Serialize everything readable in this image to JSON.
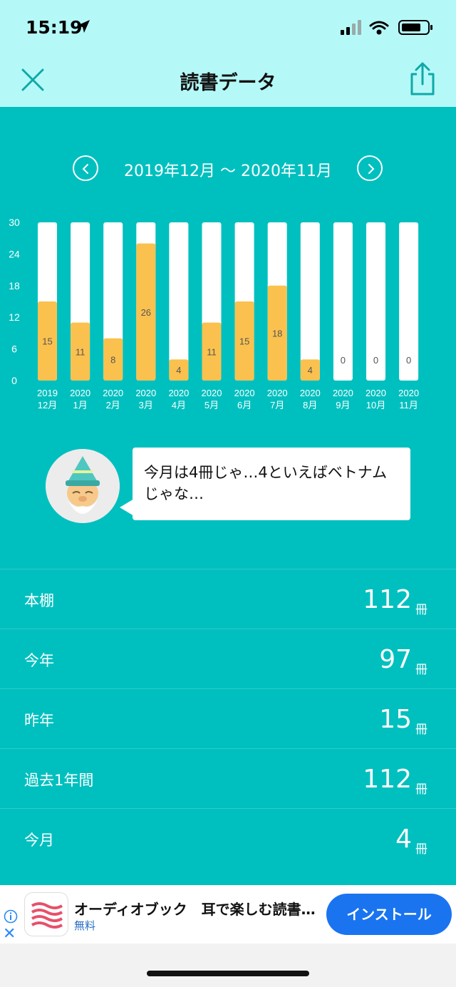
{
  "status": {
    "time": "15:19"
  },
  "nav": {
    "title": "読書データ"
  },
  "range": {
    "label": "2019年12月 〜 2020年11月"
  },
  "chart_data": {
    "type": "bar",
    "ylim": [
      0,
      30
    ],
    "yticks": [
      "30",
      "24",
      "18",
      "12",
      "6",
      "0"
    ],
    "categories": [
      [
        "2019",
        "12月"
      ],
      [
        "2020",
        "1月"
      ],
      [
        "2020",
        "2月"
      ],
      [
        "2020",
        "3月"
      ],
      [
        "2020",
        "4月"
      ],
      [
        "2020",
        "5月"
      ],
      [
        "2020",
        "6月"
      ],
      [
        "2020",
        "7月"
      ],
      [
        "2020",
        "8月"
      ],
      [
        "2020",
        "9月"
      ],
      [
        "2020",
        "10月"
      ],
      [
        "2020",
        "11月"
      ]
    ],
    "values": [
      15,
      11,
      8,
      26,
      4,
      11,
      15,
      18,
      4,
      0,
      0,
      0
    ],
    "bar_color": "#fbc14f",
    "track_color": "#ffffff"
  },
  "wizard": {
    "message": "今月は4冊じゃ…4といえばベトナムじゃな…"
  },
  "stats": [
    {
      "label": "本棚",
      "value": "112",
      "unit": "冊"
    },
    {
      "label": "今年",
      "value": "97",
      "unit": "冊"
    },
    {
      "label": "昨年",
      "value": "15",
      "unit": "冊"
    },
    {
      "label": "過去1年間",
      "value": "112",
      "unit": "冊"
    },
    {
      "label": "今月",
      "value": "4",
      "unit": "冊"
    }
  ],
  "ad": {
    "title": "オーディオブック　耳で楽しむ読書…",
    "price": "無料",
    "button": "インストール"
  },
  "colors": {
    "accent": "#00c0bf",
    "header": "#b4f9f8",
    "bar": "#fbc14f",
    "ad_button": "#1a74f0"
  }
}
